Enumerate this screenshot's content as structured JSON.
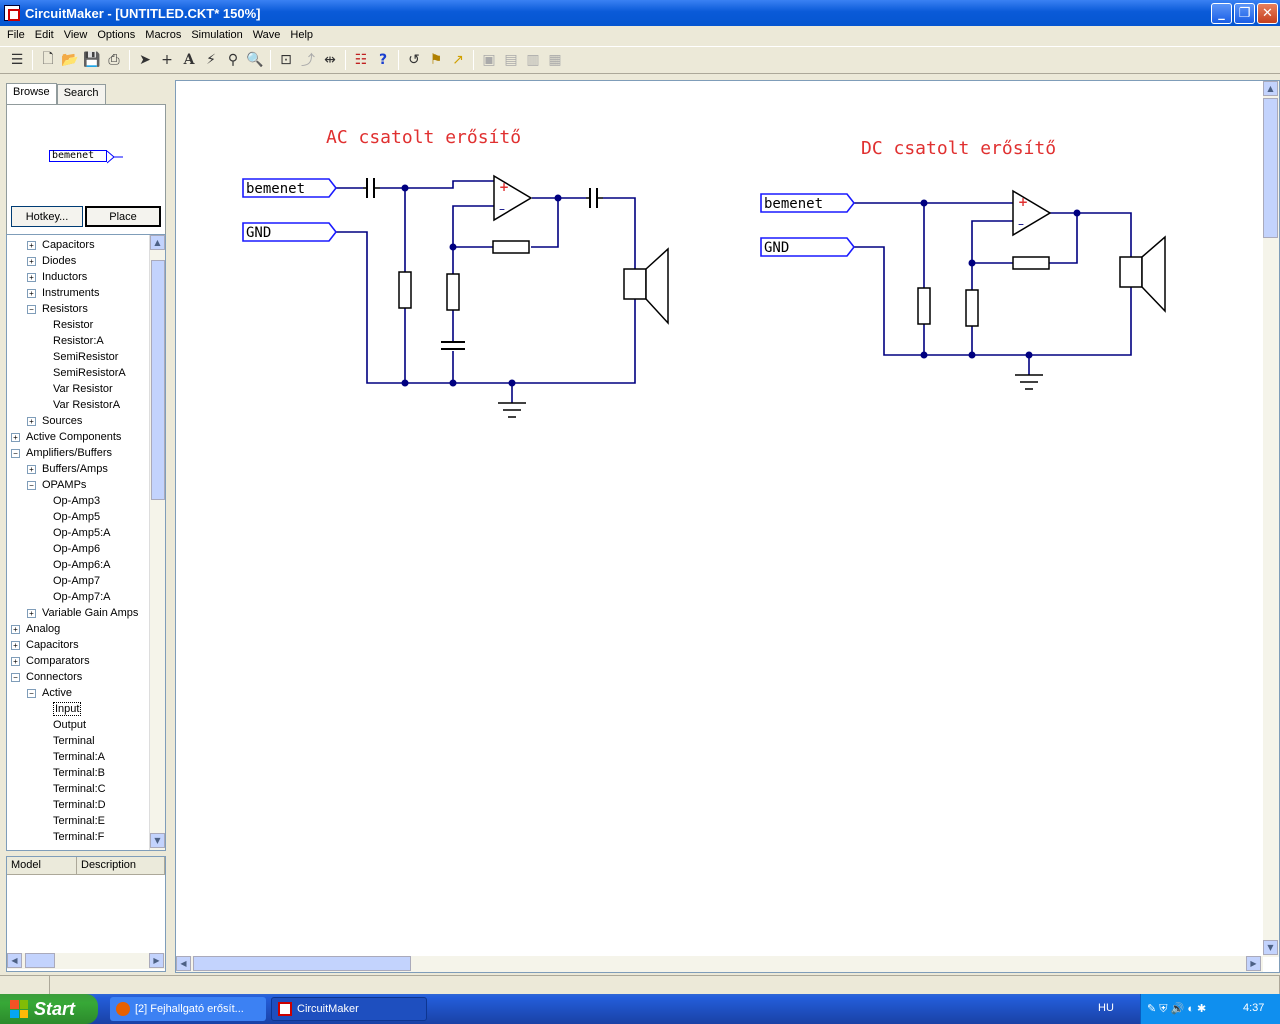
{
  "window": {
    "title": "CircuitMaker - [UNTITLED.CKT* 150%]"
  },
  "menu": [
    "File",
    "Edit",
    "View",
    "Options",
    "Macros",
    "Simulation",
    "Wave",
    "Help"
  ],
  "left_panel": {
    "tabs": [
      "Browse",
      "Search"
    ],
    "preview_label": "bemenet",
    "hotkey_label": "Hotkey...",
    "place_label": "Place",
    "tree": [
      {
        "label": "Capacitors",
        "level": 1,
        "state": "+"
      },
      {
        "label": "Diodes",
        "level": 1,
        "state": "+"
      },
      {
        "label": "Inductors",
        "level": 1,
        "state": "+"
      },
      {
        "label": "Instruments",
        "level": 1,
        "state": "+"
      },
      {
        "label": "Resistors",
        "level": 1,
        "state": "-"
      },
      {
        "label": "Resistor",
        "level": 2,
        "state": ""
      },
      {
        "label": "Resistor:A",
        "level": 2,
        "state": ""
      },
      {
        "label": "SemiResistor",
        "level": 2,
        "state": ""
      },
      {
        "label": "SemiResistorA",
        "level": 2,
        "state": ""
      },
      {
        "label": "Var Resistor",
        "level": 2,
        "state": ""
      },
      {
        "label": "Var ResistorA",
        "level": 2,
        "state": ""
      },
      {
        "label": "Sources",
        "level": 1,
        "state": "+"
      },
      {
        "label": "Active Components",
        "level": 0,
        "state": "+"
      },
      {
        "label": "Amplifiers/Buffers",
        "level": 0,
        "state": "-"
      },
      {
        "label": "Buffers/Amps",
        "level": 1,
        "state": "+"
      },
      {
        "label": "OPAMPs",
        "level": 1,
        "state": "-"
      },
      {
        "label": "Op-Amp3",
        "level": 2,
        "state": ""
      },
      {
        "label": "Op-Amp5",
        "level": 2,
        "state": ""
      },
      {
        "label": "Op-Amp5:A",
        "level": 2,
        "state": ""
      },
      {
        "label": "Op-Amp6",
        "level": 2,
        "state": ""
      },
      {
        "label": "Op-Amp6:A",
        "level": 2,
        "state": ""
      },
      {
        "label": "Op-Amp7",
        "level": 2,
        "state": ""
      },
      {
        "label": "Op-Amp7:A",
        "level": 2,
        "state": ""
      },
      {
        "label": "Variable Gain Amps",
        "level": 1,
        "state": "+"
      },
      {
        "label": "Analog",
        "level": 0,
        "state": "+"
      },
      {
        "label": "Capacitors",
        "level": 0,
        "state": "+"
      },
      {
        "label": "Comparators",
        "level": 0,
        "state": "+"
      },
      {
        "label": "Connectors",
        "level": 0,
        "state": "-"
      },
      {
        "label": "Active",
        "level": 1,
        "state": "-"
      },
      {
        "label": "Input",
        "level": 2,
        "state": "",
        "selected": true
      },
      {
        "label": "Output",
        "level": 2,
        "state": ""
      },
      {
        "label": "Terminal",
        "level": 2,
        "state": ""
      },
      {
        "label": "Terminal:A",
        "level": 2,
        "state": ""
      },
      {
        "label": "Terminal:B",
        "level": 2,
        "state": ""
      },
      {
        "label": "Terminal:C",
        "level": 2,
        "state": ""
      },
      {
        "label": "Terminal:D",
        "level": 2,
        "state": ""
      },
      {
        "label": "Terminal:E",
        "level": 2,
        "state": ""
      },
      {
        "label": "Terminal:F",
        "level": 2,
        "state": ""
      }
    ],
    "model_headers": [
      "Model",
      "Description"
    ]
  },
  "circuit": {
    "ac_title": "AC csatolt erősítő",
    "dc_title": "DC csatolt erősítő",
    "input_label": "bemenet",
    "gnd_label": "GND",
    "wire_color": "#000080",
    "title_color": "#e03030"
  },
  "taskbar": {
    "start_label": "Start",
    "tasks": [
      "[2] Fejhallgató erősít...",
      "CircuitMaker"
    ],
    "lang": "HU",
    "clock": "4:37"
  }
}
